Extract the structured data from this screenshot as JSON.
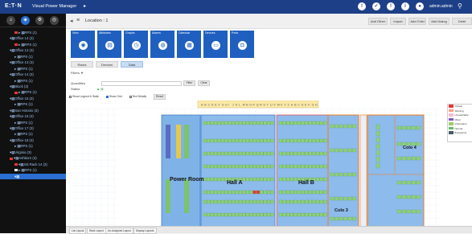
{
  "topbar": {
    "brand": "E:T·N",
    "app_name": "Visual Power Manager",
    "user": "admin.admin",
    "status_icons": [
      "alarm-icon",
      "notification-icon",
      "warning-icon",
      "info-icon",
      "user-icon"
    ],
    "colors": {
      "bar": "#1d3f87"
    }
  },
  "sidebar": {
    "nav": [
      "home-icon",
      "tree-icon",
      "gear-icon",
      "target-icon"
    ],
    "tree": [
      {
        "label": "▸ ▦RPS (1)",
        "level": 1,
        "sq": "#e53935"
      },
      {
        "label": "▾▦Office 14 (3)",
        "level": 0
      },
      {
        "label": "▸ ▦RPS (1)",
        "level": 1,
        "sq": "#e53935"
      },
      {
        "label": "▾▦Office 12 (3)",
        "level": 0
      },
      {
        "label": "▸ ▦RPS (1)",
        "level": 1
      },
      {
        "label": "▾▦Office 13 (3)",
        "level": 0
      },
      {
        "label": "▸ ▦RPS (1)",
        "level": 1
      },
      {
        "label": "▾▦Office 14 (3)",
        "level": 0
      },
      {
        "label": "▸ ▦RPS (1)",
        "level": 1
      },
      {
        "label": "▾▦Block (3)",
        "level": 0
      },
      {
        "label": "▸ ▦RPS (1)",
        "level": 1,
        "sq": "#e53935"
      },
      {
        "label": "▾▦Office 15 (3)",
        "level": 0
      },
      {
        "label": "▸ ▦RPS (1)",
        "level": 1
      },
      {
        "label": "▾▦San Antonio (3)",
        "level": 0
      },
      {
        "label": "▾▦Office 16 (3)",
        "level": 0
      },
      {
        "label": "▸ ▦RPS (1)",
        "level": 1
      },
      {
        "label": "▾▦Office 17 (3)",
        "level": 0
      },
      {
        "label": "▸ ▦RPS (1)",
        "level": 1
      },
      {
        "label": "▾▦Office 18 (3)",
        "level": 0
      },
      {
        "label": "▸ ▦RPS (1)",
        "level": 1
      },
      {
        "label": "▾▦Virginia (3)",
        "level": 0
      },
      {
        "label": "▾▦Ashburn (3)",
        "level": 0,
        "sq": "#e53935"
      },
      {
        "label": "▾▦3rd Rack 14 (3)",
        "level": 1,
        "sq": "#e53935"
      },
      {
        "label": "▸ ▦RPS (1)",
        "level": 1,
        "sq": "#ffffff"
      },
      {
        "label": "▾▦ ",
        "level": 1,
        "sel": true
      }
    ]
  },
  "locbar": {
    "location": "Location : 1",
    "buttons": [
      "Add Other",
      "Import",
      "Add Child",
      "Add Dialog",
      "Delet"
    ]
  },
  "tiles": [
    {
      "label": "View",
      "icon": "eye-icon",
      "glyph": "◉"
    },
    {
      "label": "Attributes",
      "icon": "list-icon",
      "glyph": "▤"
    },
    {
      "label": "Graphs",
      "icon": "clock-icon",
      "glyph": "◷"
    },
    {
      "label": "Alarms",
      "icon": "alarm-icon",
      "glyph": "◍"
    },
    {
      "label": "Calendar",
      "icon": "calendar-icon",
      "glyph": "▦"
    },
    {
      "label": "Devices",
      "icon": "device-icon",
      "glyph": "▭"
    },
    {
      "label": "Ports",
      "icon": "port-icon",
      "glyph": "◘"
    }
  ],
  "tabs": [
    "Racks",
    "Devices",
    "Data"
  ],
  "filters": {
    "title": "Filters ▼",
    "quantity_label": "Quantities",
    "status_label": "Status",
    "filter_button": "Filter",
    "clear_button": "Clear",
    "checkboxes": [
      {
        "label": "Show Legend & State",
        "checked": false
      },
      {
        "label": "Show Grid",
        "checked": true
      },
      {
        "label": "Text Details",
        "checked": false
      }
    ],
    "reset_button": "Reset"
  },
  "floor": {
    "column_letters": [
      "A",
      "B",
      "C",
      "D",
      "E",
      "F",
      "G",
      "H",
      "I",
      "J",
      "K",
      "L",
      "M",
      "N",
      "O",
      "P",
      "Q",
      "R",
      "S",
      "T",
      "U",
      "V",
      "W",
      "X",
      "Y",
      "Z",
      "A",
      "B",
      "C",
      "D",
      "E",
      "F",
      "G",
      "H"
    ],
    "rooms": [
      {
        "label": "Power Room"
      },
      {
        "label": "Hall A"
      },
      {
        "label": "Hall B"
      },
      {
        "label": "Colo 3"
      },
      {
        "label": "Colo 4"
      }
    ]
  },
  "legend": [
    {
      "label": "Critical",
      "color": "#e53935"
    },
    {
      "label": "Warning",
      "color": "#ff9e80"
    },
    {
      "label": "Unreachable",
      "color": "#f8bbd0"
    },
    {
      "label": "Minor",
      "color": "#7e57c2"
    },
    {
      "label": "Information",
      "color": "#9ccc65"
    },
    {
      "label": "Normal",
      "color": "#66bb6a"
    },
    {
      "label": "Exceptions",
      "color": "#455a64"
    }
  ],
  "bottombar": {
    "buttons": [
      "List Layout",
      "Rack Layout",
      "Un-Assigned Layout",
      "Display Layouts"
    ]
  }
}
